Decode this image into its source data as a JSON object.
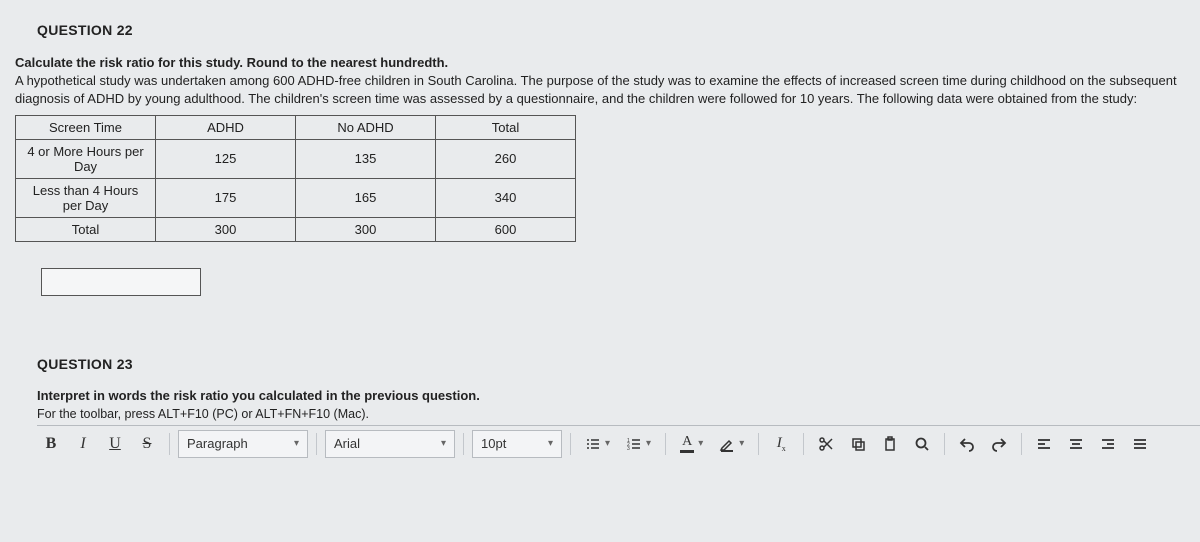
{
  "q22": {
    "title": "QUESTION 22",
    "prompt_bold": "Calculate the risk ratio for this study.  Round to the nearest hundredth.",
    "prompt_body": "A hypothetical study was undertaken among 600 ADHD-free children in South Carolina.  The purpose of the study was to examine the effects of increased screen time during childhood on the subsequent diagnosis of ADHD by young adulthood.  The children's screen time was assessed by a questionnaire, and the children were followed for 10 years.  The following data were obtained from the study:",
    "table": {
      "headers": [
        "Screen Time",
        "ADHD",
        "No ADHD",
        "Total"
      ],
      "rows": [
        [
          "4 or More Hours per Day",
          "125",
          "135",
          "260"
        ],
        [
          "Less than 4 Hours per Day",
          "175",
          "165",
          "340"
        ],
        [
          "Total",
          "300",
          "300",
          "600"
        ]
      ]
    }
  },
  "q23": {
    "title": "QUESTION 23",
    "prompt_bold": "Interpret in words the risk ratio you calculated in the previous question.",
    "toolbar_hint": "For the toolbar, press ALT+F10 (PC) or ALT+FN+F10 (Mac)."
  },
  "toolbar": {
    "bold": "B",
    "italic": "I",
    "underline": "U",
    "strike": "S",
    "block_format": "Paragraph",
    "font_family": "Arial",
    "font_size": "10pt",
    "text_color": "A"
  }
}
